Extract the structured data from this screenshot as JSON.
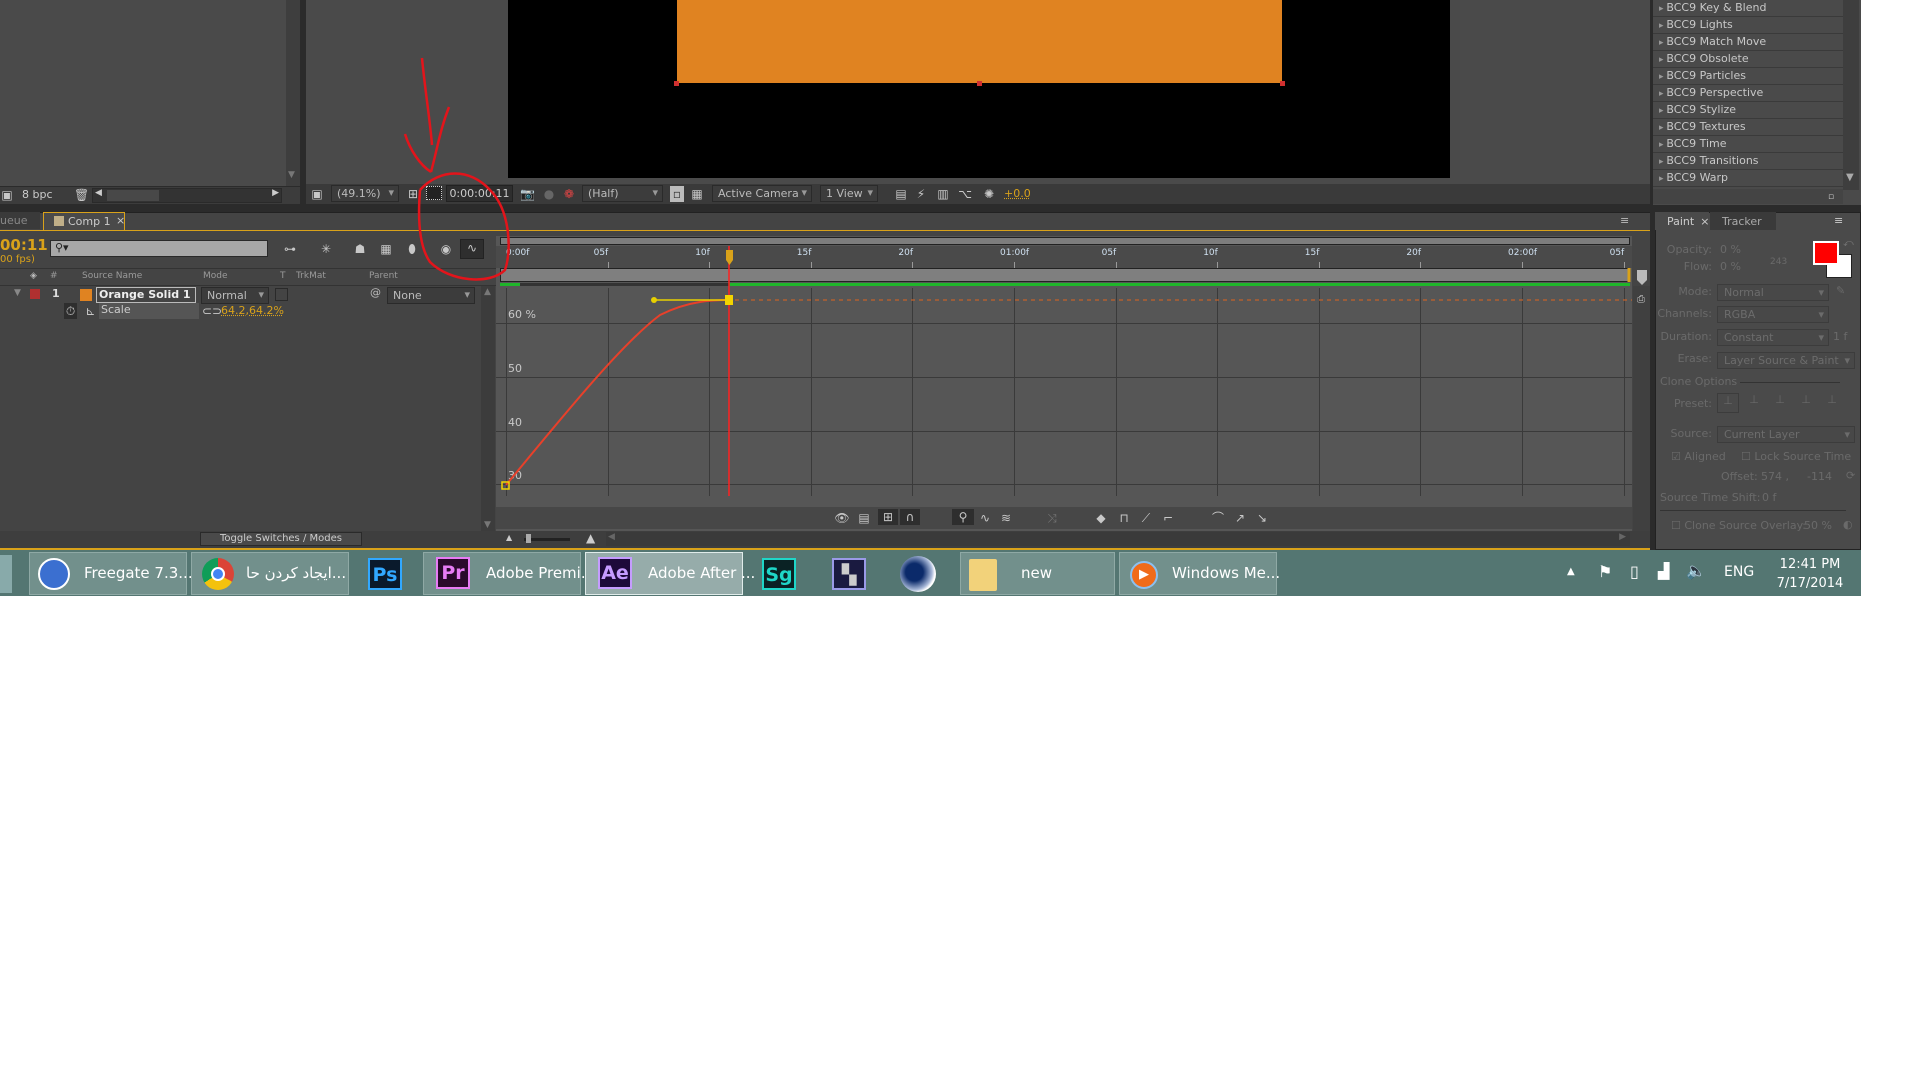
{
  "project_panel": {
    "bpc": "8 bpc"
  },
  "viewer": {
    "zoom": "(49.1%)",
    "timecode": "0:00:00:11",
    "resolution": "(Half)",
    "camera": "Active Camera",
    "views": "1 View",
    "exposure": "+0.0",
    "solid_color": "#e08321"
  },
  "effects_list": {
    "items": [
      "BCC9 Key & Blend",
      "BCC9 Lights",
      "BCC9 Match Move",
      "BCC9 Obsolete",
      "BCC9 Particles",
      "BCC9 Perspective",
      "BCC9 Stylize",
      "BCC9 Textures",
      "BCC9 Time",
      "BCC9 Transitions",
      "BCC9 Warp"
    ]
  },
  "timeline": {
    "tabs": [
      "ueue",
      "Comp 1"
    ],
    "current_time": "00:11",
    "fps": "00 fps)",
    "columns": {
      "num": "#",
      "source_name": "Source Name",
      "mode": "Mode",
      "t": "T",
      "trkmat": "TrkMat",
      "parent": "Parent"
    },
    "layer": {
      "number": "1",
      "name": "Orange Solid 1",
      "mode": "Normal",
      "parent": "None",
      "label_color": "#b03030",
      "swatch_color": "#e08321"
    },
    "property": {
      "name": "Scale",
      "value": "64.2,64.2%"
    },
    "ruler": [
      "0:00f",
      "05f",
      "10f",
      "15f",
      "20f",
      "01:00f",
      "05f",
      "10f",
      "15f",
      "20f",
      "02:00f",
      "05f"
    ],
    "toggle_label": "Toggle Switches / Modes"
  },
  "graph_editor": {
    "y_labels": [
      "60 %",
      "50",
      "40",
      "30"
    ],
    "keyframe_end_value": 64.2,
    "curve_color": "#e8402a",
    "playhead_frame": 11
  },
  "paint_panel": {
    "tabs": [
      "Paint",
      "Tracker"
    ],
    "opacity_label": "Opacity:",
    "opacity": "0 %",
    "flow_label": "Flow:",
    "flow": "0 %",
    "brush_size": "243",
    "mode_label": "Mode:",
    "mode": "Normal",
    "channels_label": "Channels:",
    "channels": "RGBA",
    "duration_label": "Duration:",
    "duration": "Constant",
    "duration_frames": "1 f",
    "erase_label": "Erase:",
    "erase": "Layer Source & Paint",
    "clone_options": "Clone Options",
    "preset_label": "Preset:",
    "source_label": "Source:",
    "source": "Current Layer",
    "aligned": "Aligned",
    "lock_source_time": "Lock Source Time",
    "offset_label": "Offset:",
    "offset_x": "574 ,",
    "offset_y": "-114",
    "source_time_shift_label": "Source Time Shift:",
    "source_time_shift": "0 f",
    "clone_overlay_label": "Clone Source Overlay:",
    "clone_overlay": "50 %",
    "foreground_color": "#ff0000",
    "background_color": "#ffffff"
  },
  "taskbar": {
    "items": [
      {
        "label": "Freegate 7.3..."
      },
      {
        "label": "ایجاد کردن حا..."
      },
      {
        "label": "Ps"
      },
      {
        "label": "Adobe Premi...",
        "icon": "Pr"
      },
      {
        "label": "Adobe After ...",
        "icon": "Ae"
      },
      {
        "label": "Sg"
      },
      {
        "label": "new"
      },
      {
        "label": "Windows Me..."
      }
    ],
    "language": "ENG",
    "time": "12:41 PM",
    "date": "7/17/2014"
  }
}
